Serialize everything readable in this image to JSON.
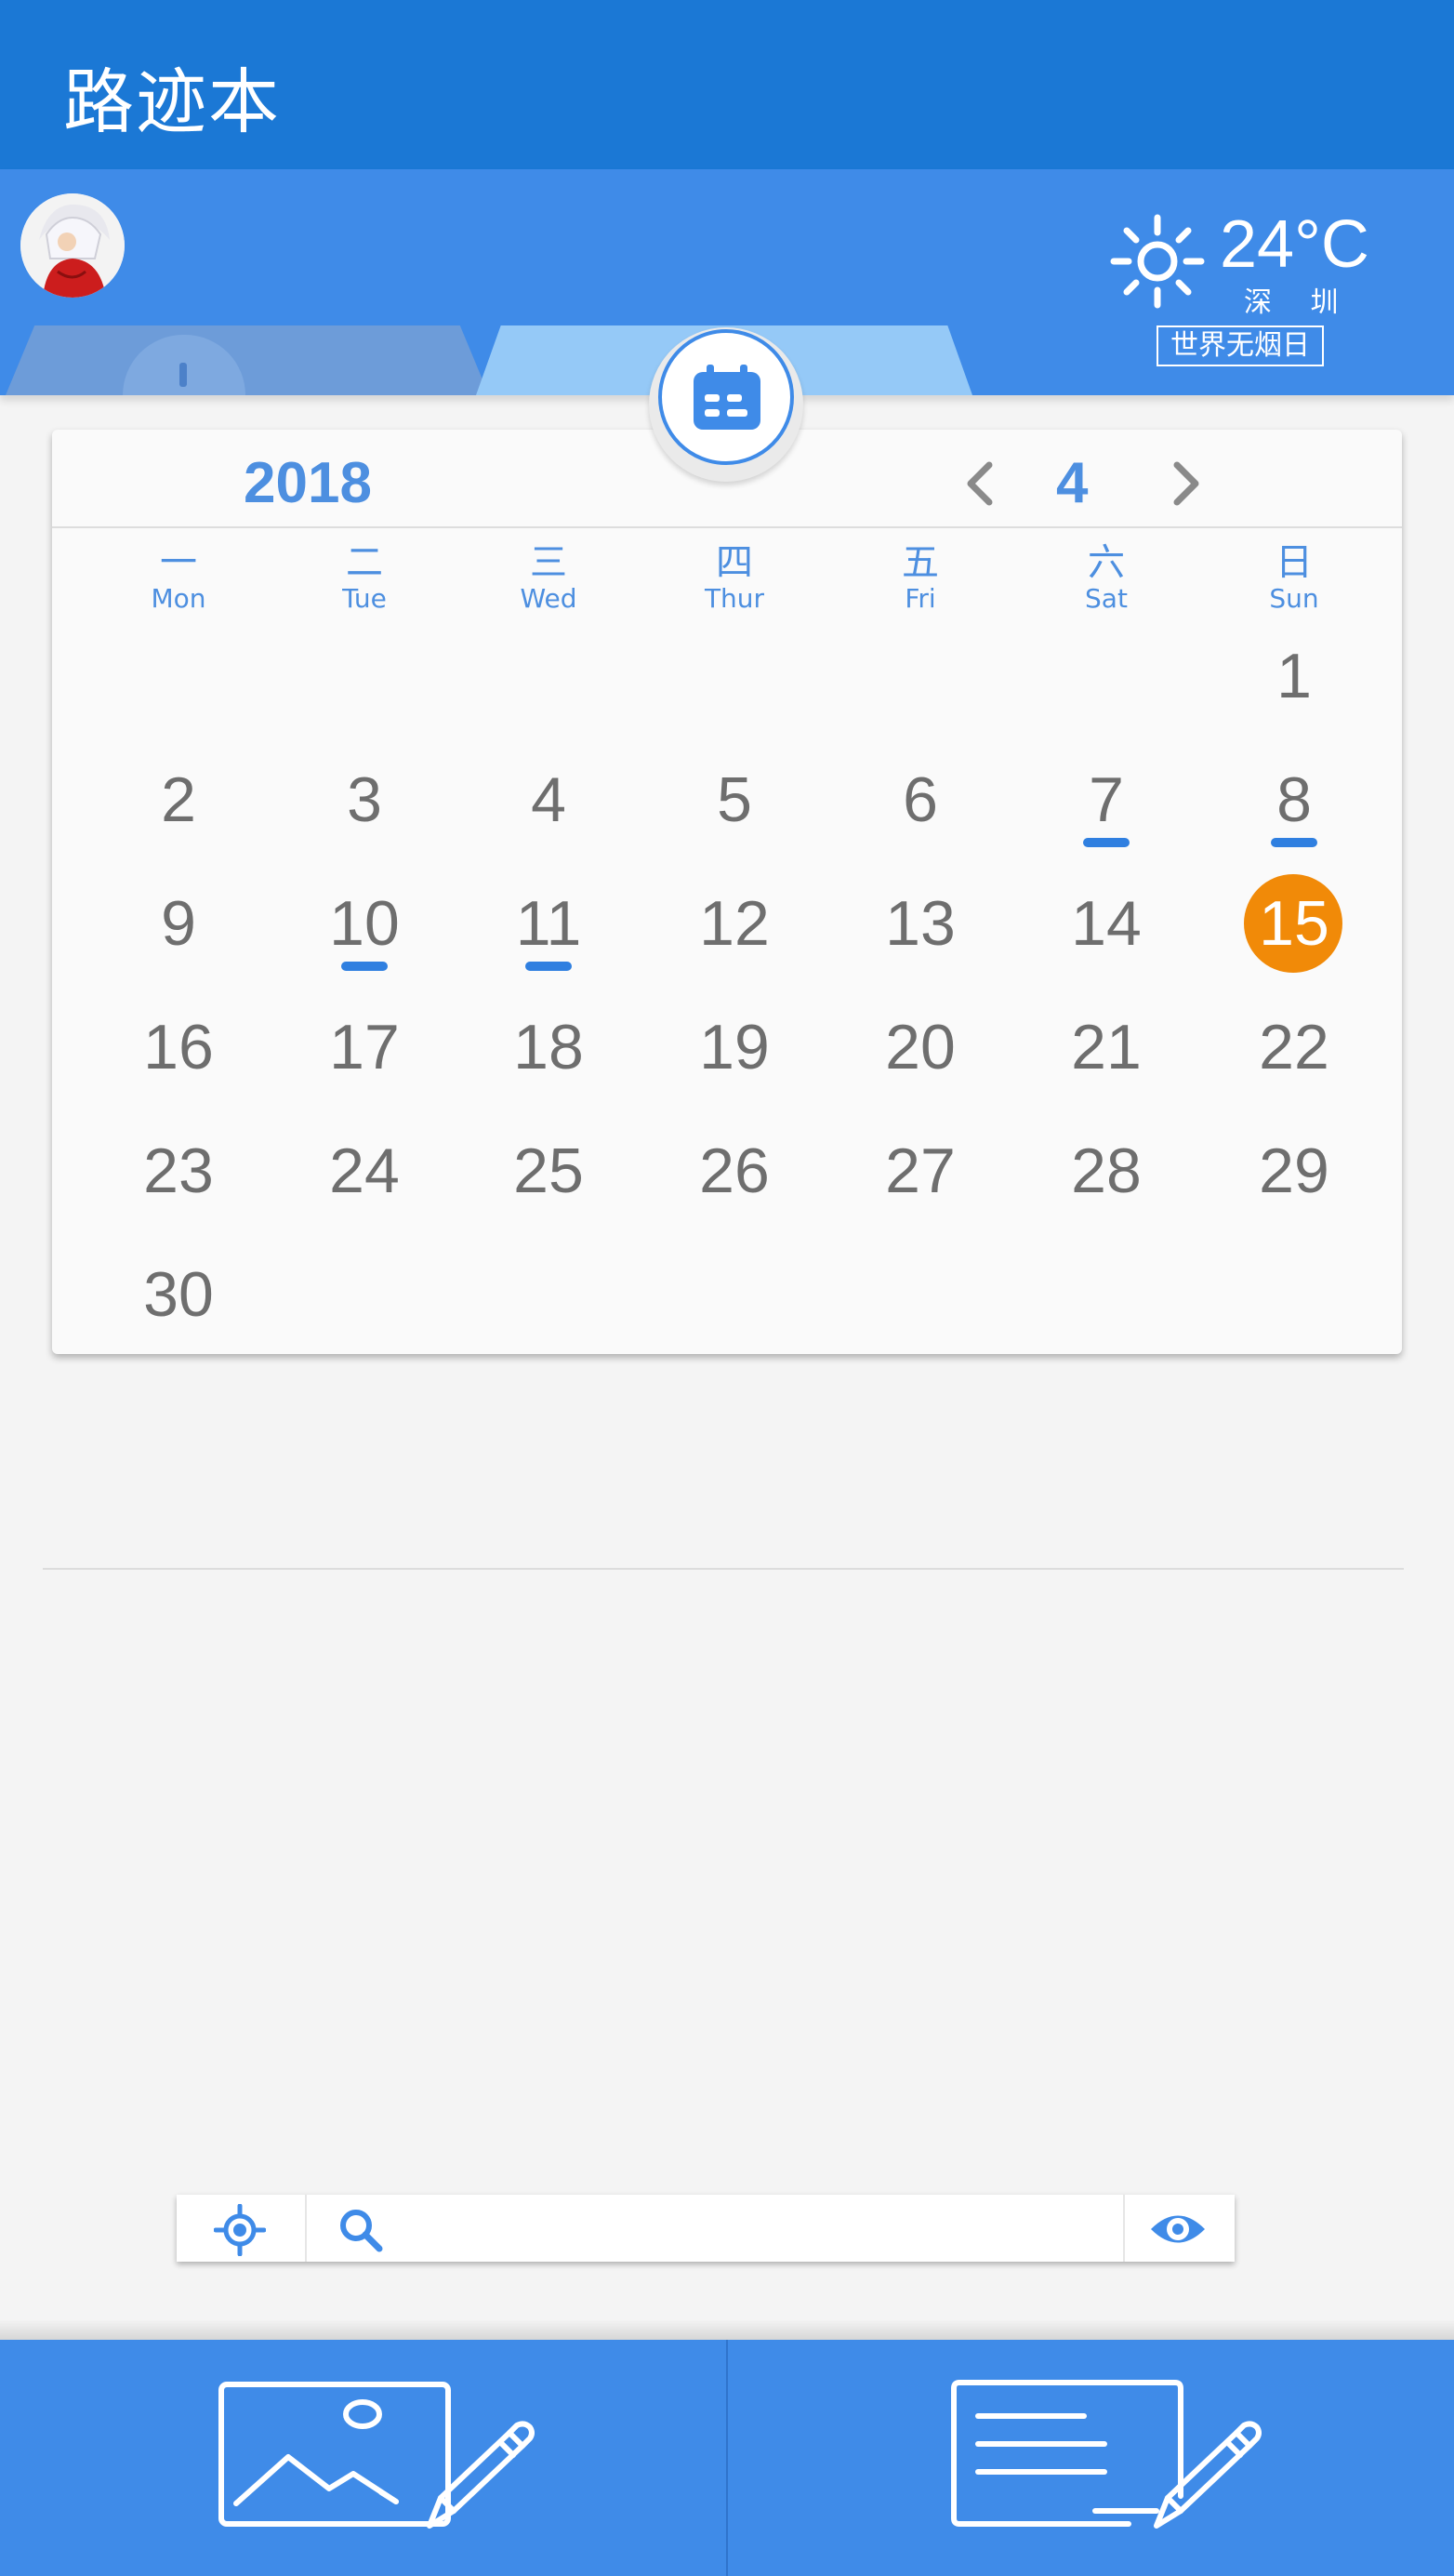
{
  "header": {
    "app_title": "路迹本"
  },
  "weather": {
    "temperature": "24°C",
    "city": "深 圳",
    "event": "世界无烟日",
    "condition_icon": "sun-icon"
  },
  "calendar": {
    "year": "2018",
    "month": "4",
    "weekdays": [
      {
        "cn": "一",
        "en": "Mon"
      },
      {
        "cn": "二",
        "en": "Tue"
      },
      {
        "cn": "三",
        "en": "Wed"
      },
      {
        "cn": "四",
        "en": "Thur"
      },
      {
        "cn": "五",
        "en": "Fri"
      },
      {
        "cn": "六",
        "en": "Sat"
      },
      {
        "cn": "日",
        "en": "Sun"
      }
    ],
    "days": [
      "1",
      "2",
      "3",
      "4",
      "5",
      "6",
      "7",
      "8",
      "9",
      "10",
      "11",
      "12",
      "13",
      "14",
      "15",
      "16",
      "17",
      "18",
      "19",
      "20",
      "21",
      "22",
      "23",
      "24",
      "25",
      "26",
      "27",
      "28",
      "29",
      "30"
    ],
    "first_weekday_index": 6,
    "today": "15",
    "marked_days": [
      "7",
      "8",
      "10",
      "11"
    ],
    "colors": {
      "accent": "#4d8fe0",
      "today": "#f18a08",
      "mark": "#2f7fe0",
      "day_text": "#6e6e6e"
    }
  },
  "search": {
    "value": "",
    "placeholder": ""
  },
  "colors": {
    "topbar": "#1b78d5",
    "header": "#3f8be8",
    "bottom_bar": "#3f8be8"
  }
}
